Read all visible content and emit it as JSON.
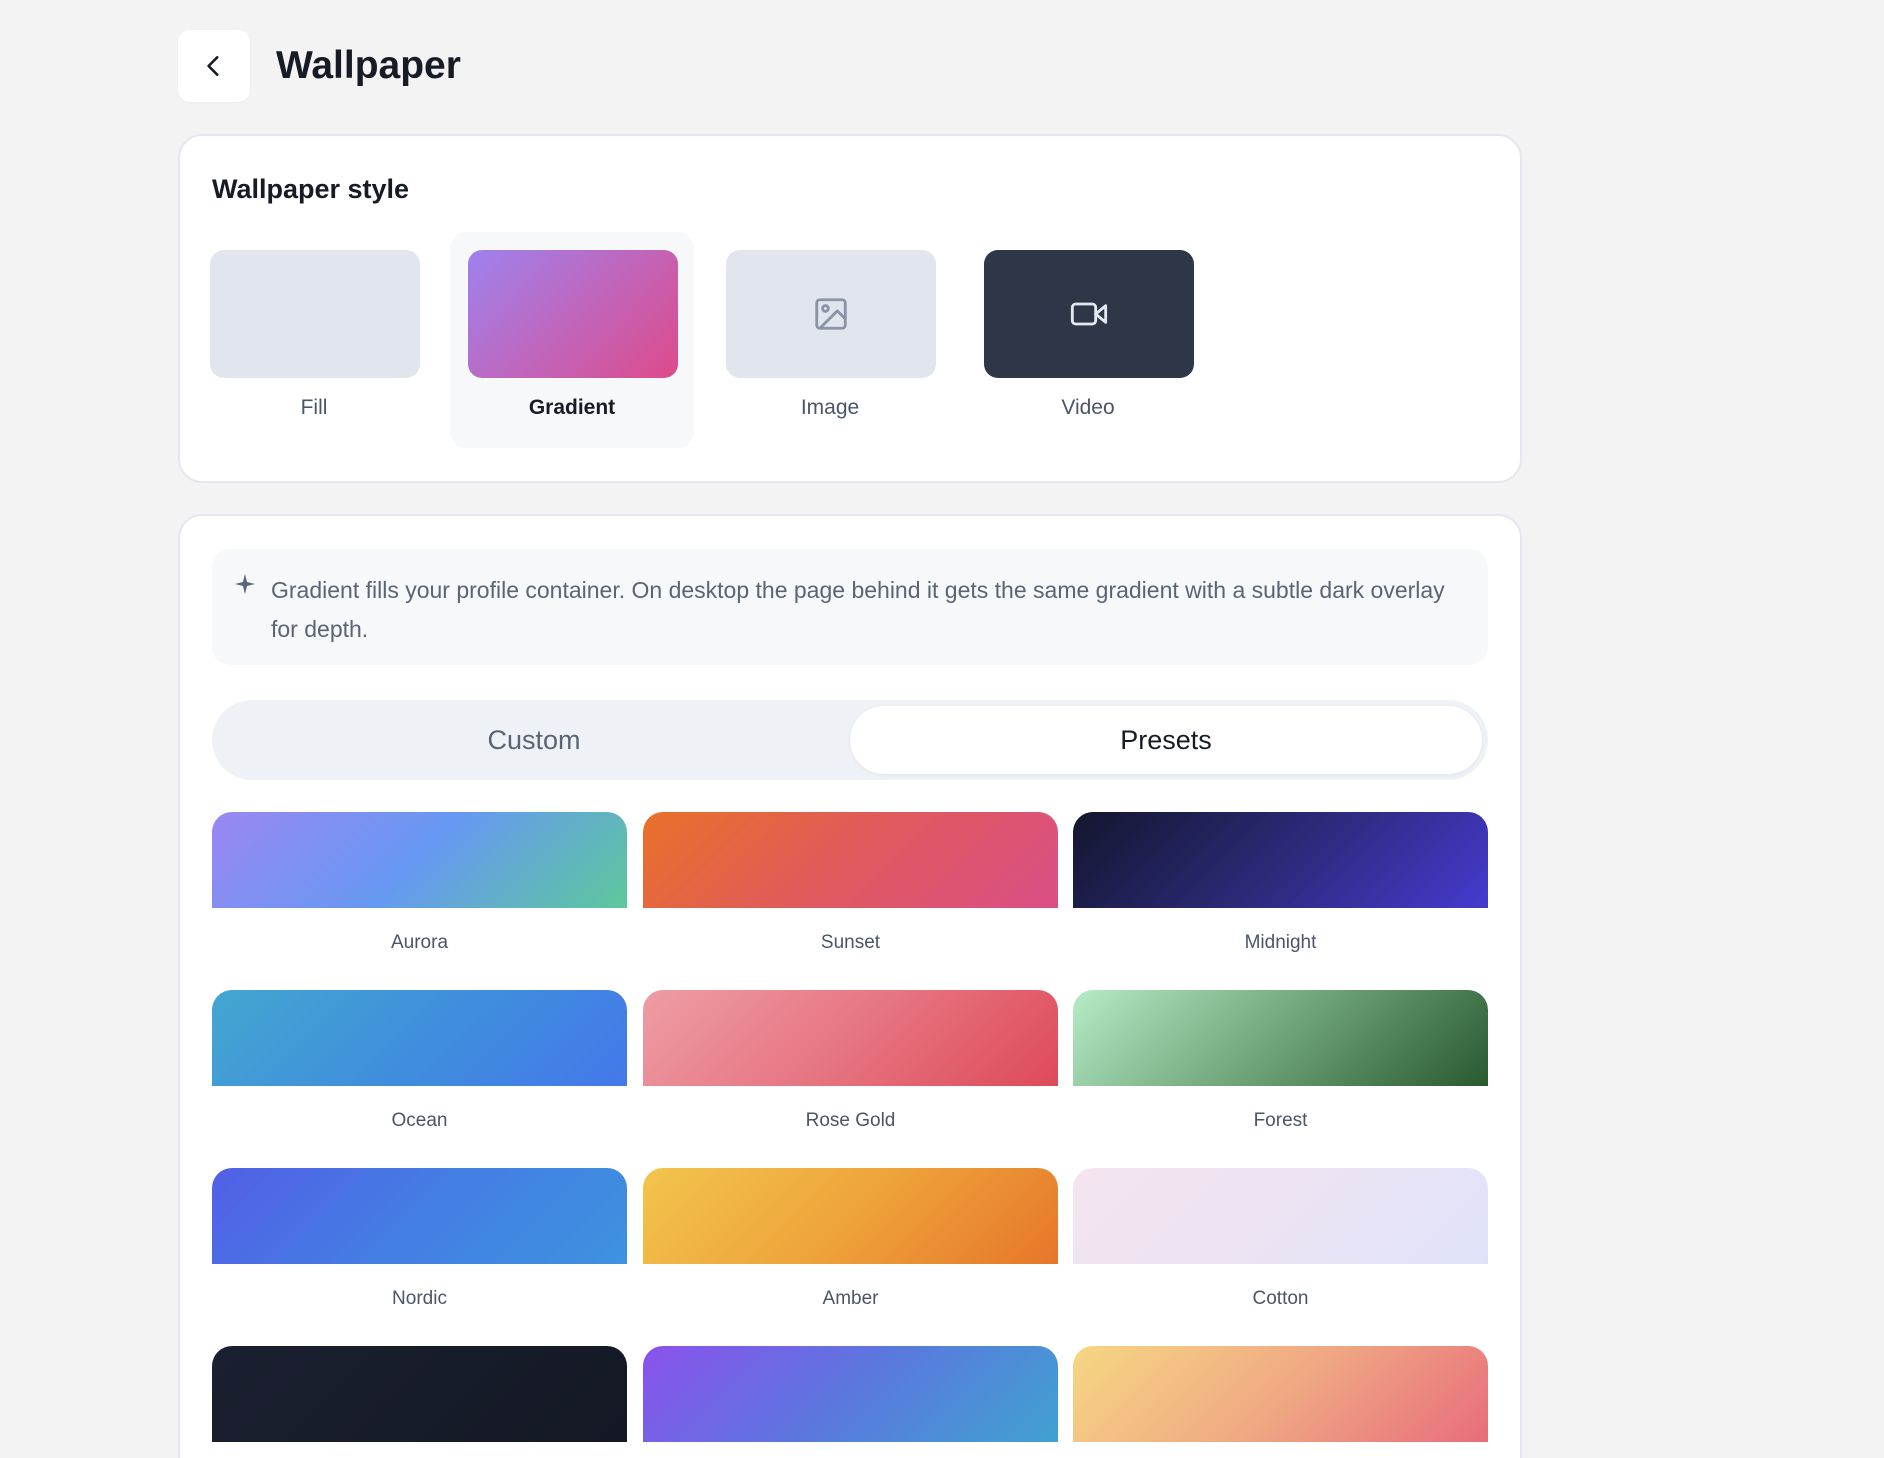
{
  "header": {
    "title": "Wallpaper"
  },
  "style_card": {
    "title": "Wallpaper style",
    "options": [
      {
        "label": "Fill",
        "icon": "none",
        "selected": false
      },
      {
        "label": "Gradient",
        "icon": "none",
        "selected": true
      },
      {
        "label": "Image",
        "icon": "image-icon",
        "selected": false
      },
      {
        "label": "Video",
        "icon": "video-camera-icon",
        "selected": false
      }
    ]
  },
  "info": {
    "icon": "sparkle-icon",
    "text": "Gradient fills your profile container. On desktop the page behind it gets the same gradient with a subtle dark overlay for depth."
  },
  "tabs": [
    {
      "label": "Custom",
      "active": false
    },
    {
      "label": "Presets",
      "active": true
    }
  ],
  "presets": [
    {
      "label": "Aurora",
      "from": "#9a87f3",
      "mid": "#6699f1",
      "to": "#5dc89b"
    },
    {
      "label": "Sunset",
      "from": "#e8712a",
      "mid": "#e0595d",
      "to": "#d94f86"
    },
    {
      "label": "Midnight",
      "from": "#13162e",
      "mid": "#2b2a78",
      "to": "#453ad0"
    },
    {
      "label": "Ocean",
      "from": "#44a6d0",
      "mid": "#3f8fdc",
      "to": "#4478ea"
    },
    {
      "label": "Rose Gold",
      "from": "#ee9da4",
      "mid": "#e67582",
      "to": "#de4a57"
    },
    {
      "label": "Forest",
      "from": "#b5ecc6",
      "mid": "#6fa378",
      "to": "#29592f"
    },
    {
      "label": "Nordic",
      "from": "#525fe6",
      "mid": "#437ee3",
      "to": "#3e92e0"
    },
    {
      "label": "Amber",
      "from": "#f2c54d",
      "mid": "#eea33b",
      "to": "#e6762a"
    },
    {
      "label": "Cotton",
      "from": "#f4e4ef",
      "mid": "#ece3f3",
      "to": "#dfe3fa"
    },
    {
      "label": "",
      "from": "#1b2030",
      "mid": "#171c2a",
      "to": "#141825"
    },
    {
      "label": "",
      "from": "#8a52ec",
      "mid": "#5a78de",
      "to": "#40a2d0"
    },
    {
      "label": "",
      "from": "#f6d783",
      "mid": "#f0a983",
      "to": "#e86d7c"
    }
  ]
}
